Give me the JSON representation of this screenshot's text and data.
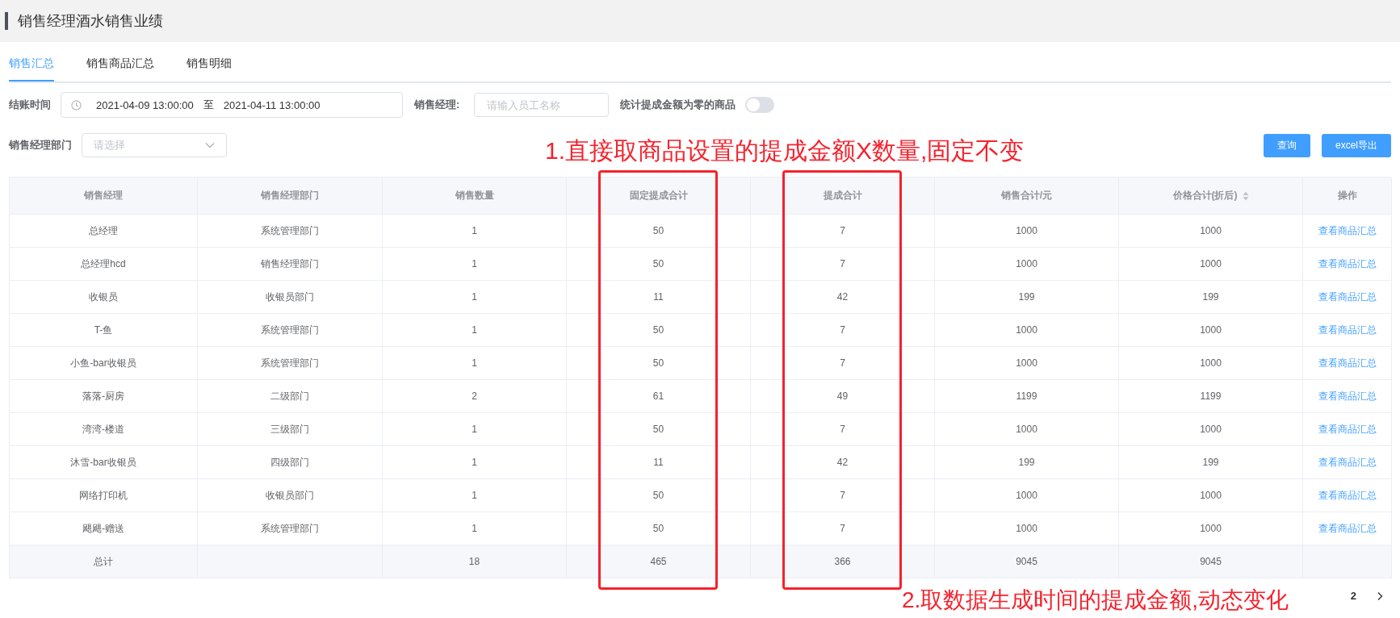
{
  "page_title": "销售经理酒水销售业绩",
  "tabs": [
    {
      "label": "销售汇总",
      "selected": true
    },
    {
      "label": "销售商品汇总",
      "selected": false
    },
    {
      "label": "销售明细",
      "selected": false
    }
  ],
  "filters": {
    "checkout_time": {
      "label": "结账时间",
      "start": "2021-04-09 13:00:00",
      "separator": "至",
      "end": "2021-04-11 13:00:00"
    },
    "manager": {
      "label": "销售经理:",
      "placeholder": "请输入员工名称"
    },
    "zero_toggle": {
      "label": "统计提成金额为零的商品",
      "on": false
    },
    "department": {
      "label": "销售经理部门",
      "placeholder": "请选择"
    }
  },
  "buttons": {
    "query": "查询",
    "export": "excel导出"
  },
  "table": {
    "columns": [
      {
        "label": "销售经理",
        "sortable": false,
        "highlighted": false
      },
      {
        "label": "销售经理部门",
        "sortable": false,
        "highlighted": false
      },
      {
        "label": "销售数量",
        "sortable": false,
        "highlighted": false
      },
      {
        "label": "固定提成合计",
        "sortable": false,
        "highlighted": true
      },
      {
        "label": "提成合计",
        "sortable": false,
        "highlighted": true
      },
      {
        "label": "销售合计/元",
        "sortable": false,
        "highlighted": false
      },
      {
        "label": "价格合计(折后)",
        "sortable": true,
        "highlighted": false
      },
      {
        "label": "操作",
        "sortable": false,
        "highlighted": false
      }
    ],
    "rows": [
      {
        "cells": [
          "总经理",
          "系统管理部门",
          "1",
          "50",
          "7",
          "1000",
          "1000"
        ],
        "action": "查看商品汇总"
      },
      {
        "cells": [
          "总经理hcd",
          "销售经理部门",
          "1",
          "50",
          "7",
          "1000",
          "1000"
        ],
        "action": "查看商品汇总"
      },
      {
        "cells": [
          "收银员",
          "收银员部门",
          "1",
          "11",
          "42",
          "199",
          "199"
        ],
        "action": "查看商品汇总"
      },
      {
        "cells": [
          "T-鱼",
          "系统管理部门",
          "1",
          "50",
          "7",
          "1000",
          "1000"
        ],
        "action": "查看商品汇总"
      },
      {
        "cells": [
          "小鱼-bar收银员",
          "系统管理部门",
          "1",
          "50",
          "7",
          "1000",
          "1000"
        ],
        "action": "查看商品汇总"
      },
      {
        "cells": [
          "落落-厨房",
          "二级部门",
          "2",
          "61",
          "49",
          "1199",
          "1199"
        ],
        "action": "查看商品汇总"
      },
      {
        "cells": [
          "湾湾-楼道",
          "三级部门",
          "1",
          "50",
          "7",
          "1000",
          "1000"
        ],
        "action": "查看商品汇总"
      },
      {
        "cells": [
          "沐雪-bar收银员",
          "四级部门",
          "1",
          "11",
          "42",
          "199",
          "199"
        ],
        "action": "查看商品汇总"
      },
      {
        "cells": [
          "网络打印机",
          "收银员部门",
          "1",
          "50",
          "7",
          "1000",
          "1000"
        ],
        "action": "查看商品汇总"
      },
      {
        "cells": [
          "飓飓-赠送",
          "系统管理部门",
          "1",
          "50",
          "7",
          "1000",
          "1000"
        ],
        "action": "查看商品汇总"
      }
    ],
    "total": {
      "cells": [
        "总计",
        "",
        "18",
        "465",
        "366",
        "9045",
        "9045"
      ]
    }
  },
  "pagination": {
    "page": "2"
  },
  "annotations": [
    {
      "text": "1.直接取商品设置的提成金额X数量,固定不变"
    },
    {
      "text": "2.取数据生成时间的提成金额,动态变化"
    }
  ]
}
